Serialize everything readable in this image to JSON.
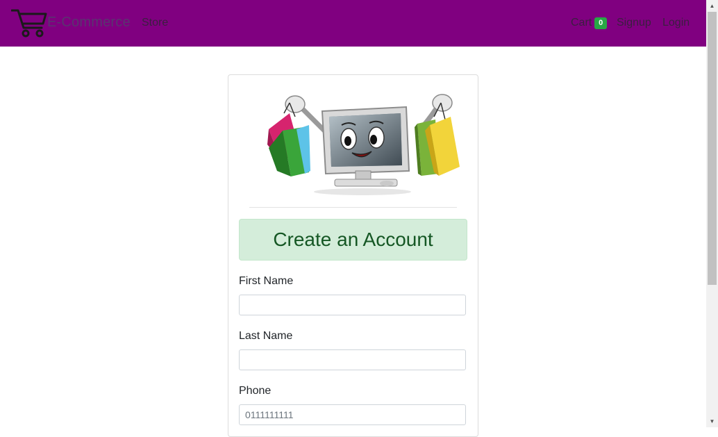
{
  "navbar": {
    "brand": "E-Commerce",
    "store": "Store",
    "cart": "Cart",
    "cart_count": "0",
    "signup": "Signup",
    "login": "Login"
  },
  "form": {
    "title": "Create an Account",
    "first_name_label": "First Name",
    "first_name_value": "",
    "last_name_label": "Last Name",
    "last_name_value": "",
    "phone_label": "Phone",
    "phone_placeholder": "0111111111"
  },
  "colors": {
    "navbar_bg": "#800080",
    "alert_bg": "#d4edda",
    "alert_text": "#155724",
    "badge": "#28a745"
  },
  "icons": {
    "brand": "shopping-cart-icon",
    "hero": "computer-with-shopping-bags-illustration"
  }
}
